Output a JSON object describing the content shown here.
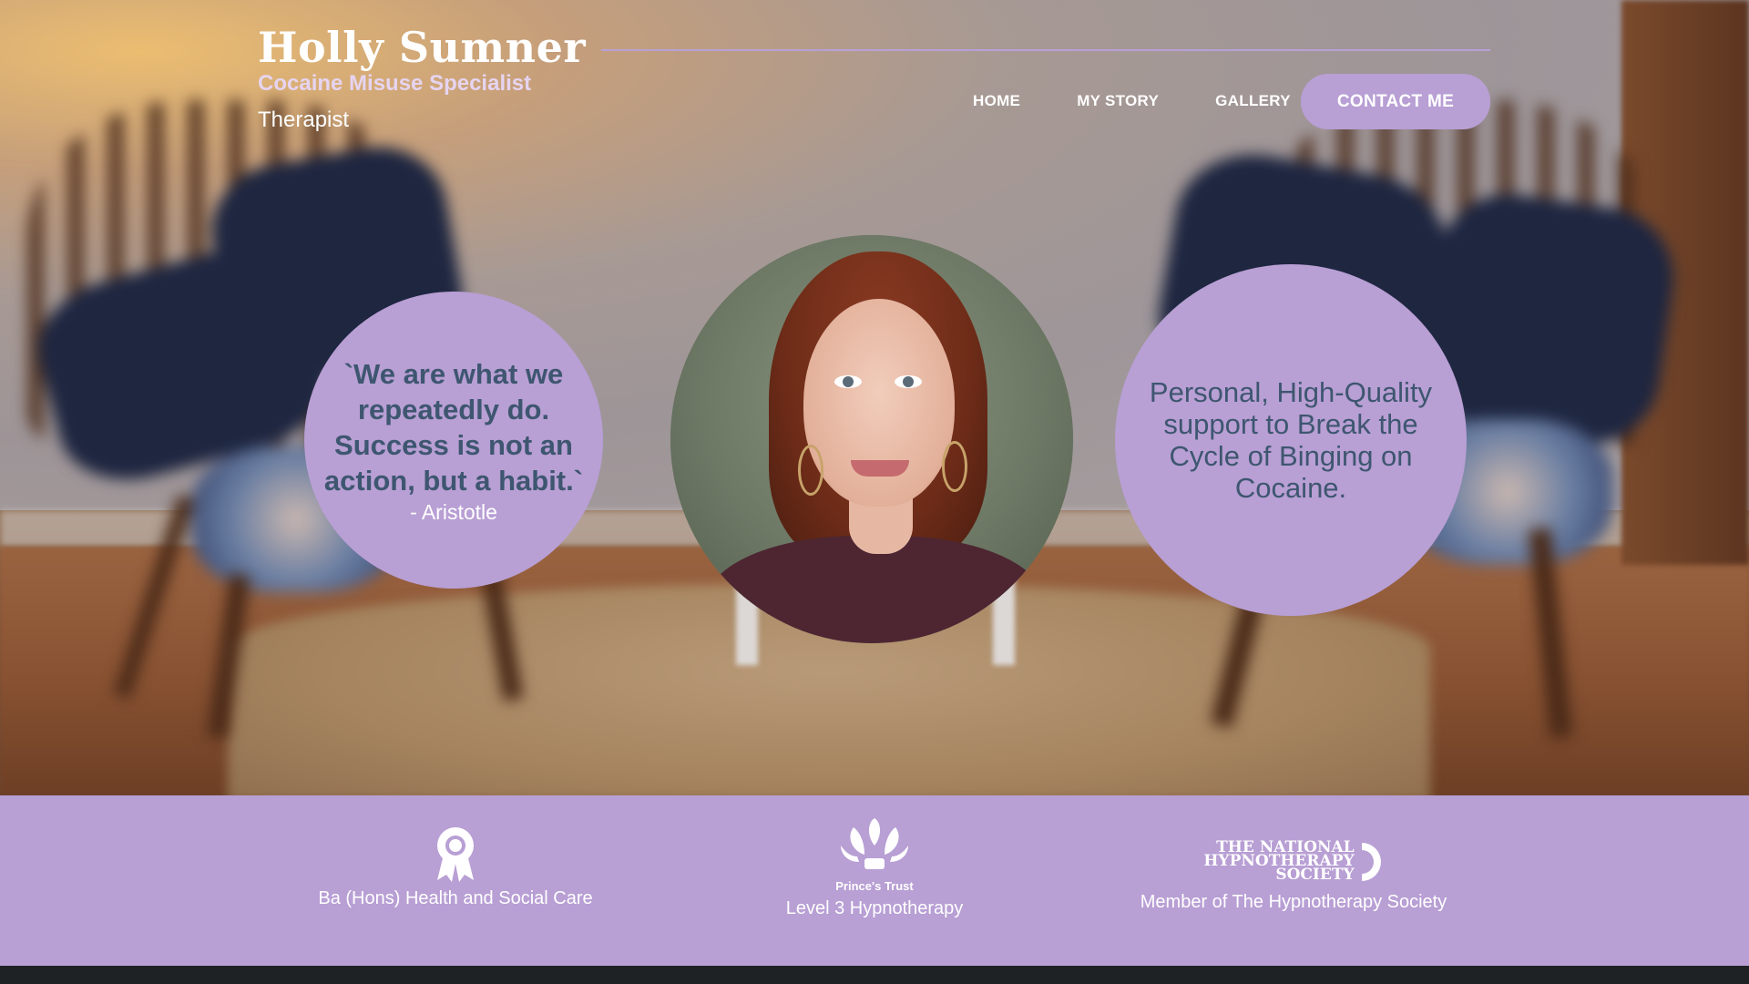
{
  "header": {
    "brand_name": "Holly Sumner",
    "brand_subtitle": "Cocaine Misuse Specialist",
    "brand_role": "Therapist"
  },
  "nav": {
    "items": [
      {
        "label": "HOME"
      },
      {
        "label": "MY STORY"
      },
      {
        "label": "GALLERY"
      }
    ],
    "contact_label": "CONTACT ME"
  },
  "hero": {
    "quote": "`We are what we repeatedly do. Success is not an action, but a habit.`",
    "quote_author": "- Aristotle",
    "tagline": "Personal, High-Quality support to Break the Cycle of Binging on Cocaine."
  },
  "credentials": [
    {
      "icon": "award-ribbon-icon",
      "label": "Ba (Hons) Health and Social Care"
    },
    {
      "icon": "princes-trust-feathers-icon",
      "logo_text": "Prince's Trust",
      "label": "Level 3 Hypnotherapy"
    },
    {
      "icon": "national-hypnotherapy-society-logo",
      "logo_lines": [
        "THE NATIONAL",
        "HYPNOTHERAPY",
        "SOCIETY"
      ],
      "label": "Member of The Hypnotherapy Society"
    }
  ],
  "colors": {
    "accent": "#b89fd4",
    "quote_text": "#3e5670",
    "bottom_bar": "#1e2224"
  }
}
